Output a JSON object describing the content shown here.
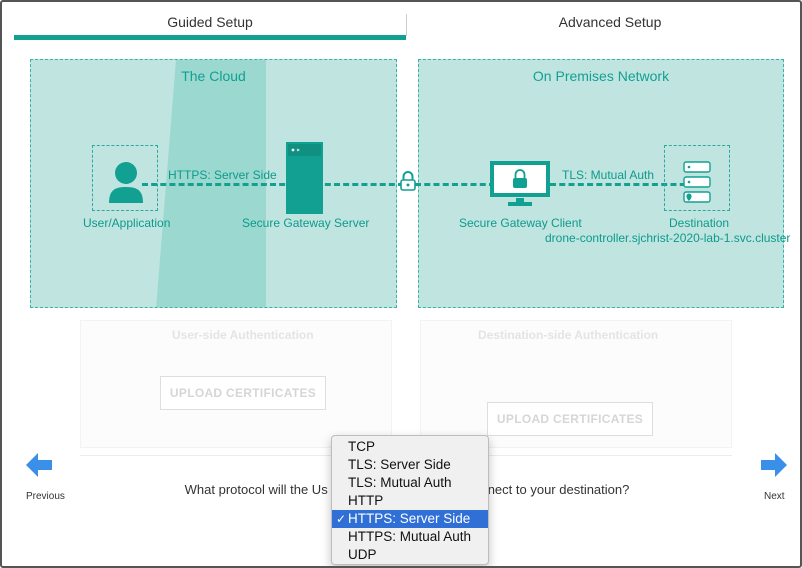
{
  "tabs": {
    "guided": "Guided Setup",
    "advanced": "Advanced Setup"
  },
  "cloud": {
    "title": "The Cloud",
    "user_label": "User/Application",
    "gateway_label": "Secure Gateway Server",
    "link_label": "HTTPS: Server Side"
  },
  "premises": {
    "title": "On Premises Network",
    "client_label": "Secure Gateway Client",
    "destination_label": "Destination",
    "destination_host": "drone-controller.sjchrist-2020-lab-1.svc.cluster",
    "link_label": "TLS: Mutual Auth"
  },
  "auth": {
    "user_side": "User-side Authentication",
    "destination_side": "Destination-side Authentication",
    "upload_label": "UPLOAD CERTIFICATES"
  },
  "nav": {
    "previous": "Previous",
    "next": "Next"
  },
  "question": {
    "before": "What protocol will the Us",
    "after": "nect to your destination?"
  },
  "protocol_dropdown": {
    "options": [
      "TCP",
      "TLS: Server Side",
      "TLS: Mutual Auth",
      "HTTP",
      "HTTPS: Server Side",
      "HTTPS: Mutual Auth",
      "UDP"
    ],
    "selected": "HTTPS: Server Side",
    "check_mark": "✓"
  },
  "colors": {
    "accent": "#12a092",
    "panel": "#c0e5e1",
    "cloud_band": "#8fd3c9",
    "selection": "#2f6fd6",
    "nav_arrow": "#3a8fe8"
  }
}
